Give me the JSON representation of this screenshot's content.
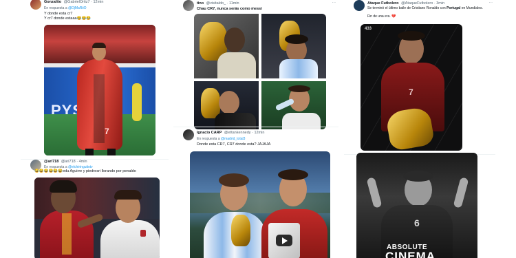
{
  "col1": {
    "tweet1": {
      "name": "Gonzalito",
      "handle": "@GabrielOrtiz7",
      "time": "12min",
      "reply_prefix": "En respuesta a",
      "reply_to": "@DjMaRiiO",
      "lines": [
        "Y donde esta cr7",
        "Y cr7 donde estaaa😂😂😂"
      ]
    },
    "tweet2": {
      "name": "@ari718",
      "handle": "@ari718",
      "time": "4min",
      "reply_prefix": "En respuesta a",
      "reply_to": "@elchiringuitotv",
      "text": "😂😂😂😂😂😂edu Aguirre y piedresri llorando por penaldo"
    }
  },
  "col2": {
    "tweet1": {
      "name": "tino",
      "handle": "@visitaldo_",
      "time": "11min",
      "text": "Chau CR7, nunca serás como messi"
    },
    "tweet2": {
      "name": "Ignacio CARP",
      "handle": "@ettankennedy",
      "time": "12min",
      "reply_prefix": "En respuesta a",
      "reply_to": "@madrid_total3",
      "text": "Donde esta CR7, CR7 donde esta? JAJAJA"
    }
  },
  "col3": {
    "tweet1": {
      "name": "Ataque Futbolero",
      "handle": "@AtaqueFutbolero",
      "time": "3min",
      "line1_pre": "Se terminó el último baile de Cristiano Ronaldo con",
      "line1_bold": "Portugal",
      "line1_post": "en Mundiales.",
      "line2": "Fin de una era. 💔",
      "media_logo": "433"
    },
    "tweet2": {
      "media_caption_top": "ABSOLUTE",
      "media_caption_bottom": "CINEMA",
      "media_number": "6"
    }
  },
  "icons": {
    "menu": "⋯",
    "grok": "◇",
    "verified": "✓"
  },
  "col1_media_text": "PYS",
  "col1_media_number": "7"
}
